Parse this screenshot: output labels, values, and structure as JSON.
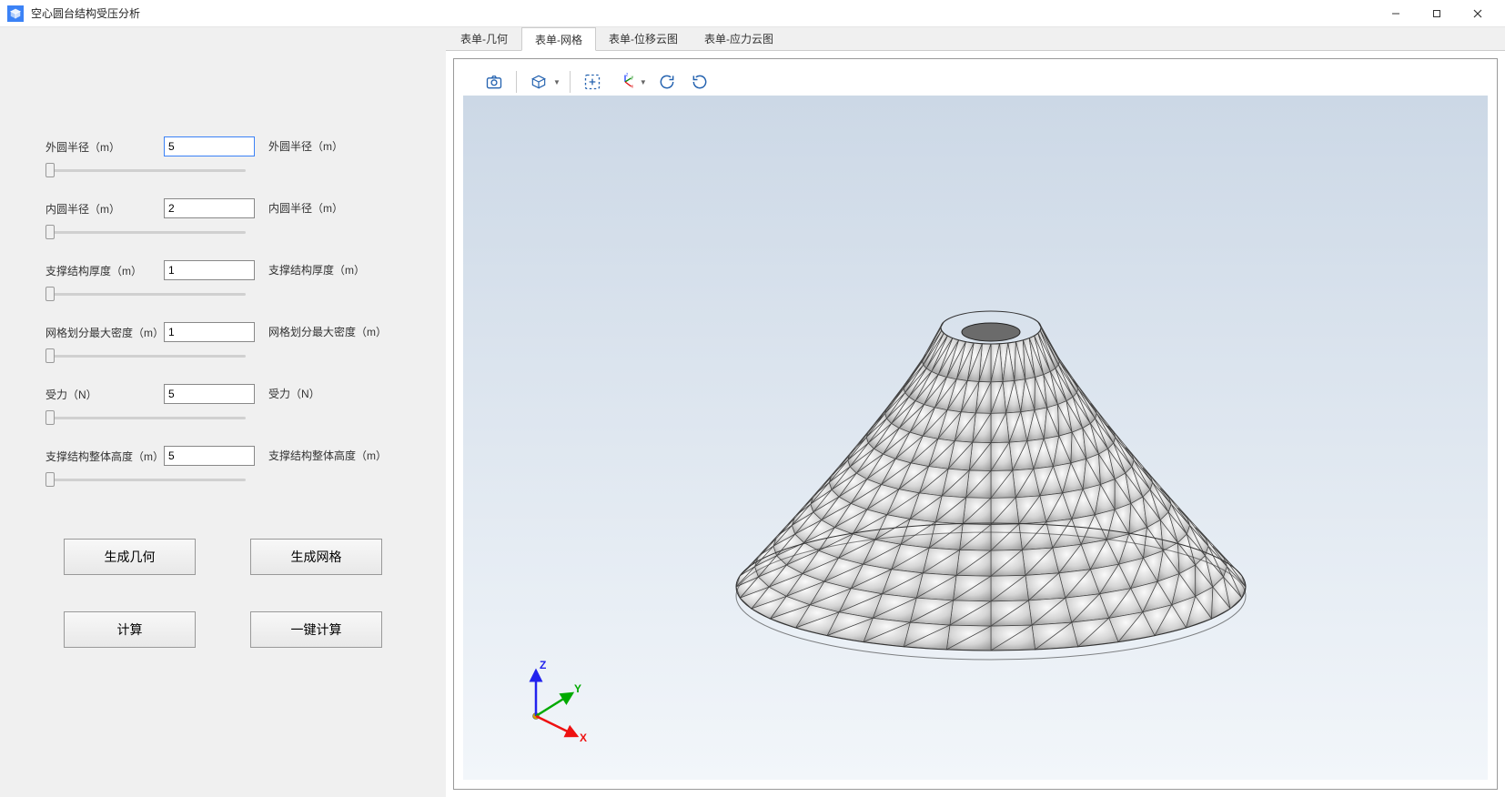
{
  "window": {
    "title": "空心圆台结构受压分析"
  },
  "form": {
    "fields": [
      {
        "label": "外圆半径（m）",
        "value": "5",
        "echo": "外圆半径（m）",
        "highlighted": true
      },
      {
        "label": "内圆半径（m）",
        "value": "2",
        "echo": "内圆半径（m）",
        "highlighted": false
      },
      {
        "label": "支撑结构厚度（m）",
        "value": "1",
        "echo": "支撑结构厚度（m）",
        "highlighted": false
      },
      {
        "label": "网格划分最大密度（m）",
        "value": "1",
        "echo": "网格划分最大密度（m）",
        "highlighted": false
      },
      {
        "label": "受力（N）",
        "value": "5",
        "echo": "受力（N）",
        "highlighted": false
      },
      {
        "label": "支撑结构整体高度（m）",
        "value": "5",
        "echo": "支撑结构整体高度（m）",
        "highlighted": false
      }
    ]
  },
  "buttons": {
    "gen_geometry": "生成几何",
    "gen_mesh": "生成网格",
    "compute": "计算",
    "one_click": "一键计算"
  },
  "tabs": {
    "items": [
      {
        "label": "表单-几何"
      },
      {
        "label": "表单-网格"
      },
      {
        "label": "表单-位移云图"
      },
      {
        "label": "表单-应力云图"
      }
    ],
    "active_index": 1
  },
  "axes": {
    "x": "X",
    "y": "Y",
    "z": "Z"
  }
}
